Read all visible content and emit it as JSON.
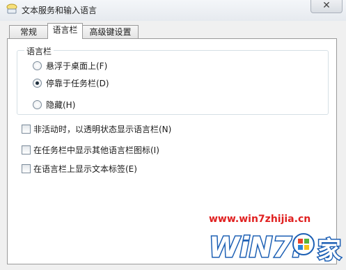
{
  "window": {
    "title": "文本服务和输入语言",
    "close_label": "✕"
  },
  "tabs": [
    {
      "label": "常规",
      "active": false
    },
    {
      "label": "语言栏",
      "active": true
    },
    {
      "label": "高级键设置",
      "active": false
    }
  ],
  "language_bar_group": {
    "legend": "语言栏",
    "options": [
      {
        "label": "悬浮于桌面上(F)",
        "checked": false
      },
      {
        "label": "停靠于任务栏(D)",
        "checked": true
      },
      {
        "label": "隐藏(H)",
        "checked": false
      }
    ]
  },
  "checkboxes": [
    {
      "label": "非活动时，以透明状态显示语言栏(N)",
      "checked": false
    },
    {
      "label": "在任务栏中显示其他语言栏图标(I)",
      "checked": false
    },
    {
      "label": "在语言栏上显示文本标签(E)",
      "checked": false
    }
  ],
  "watermark": {
    "url": "www.win7zhijia.cn",
    "logo_text": "WiN7.",
    "logo_char": "家",
    "colors": {
      "url": "#e02020",
      "logo_blue": "#1c5fb4",
      "logo_red": "#d91c1c"
    }
  }
}
